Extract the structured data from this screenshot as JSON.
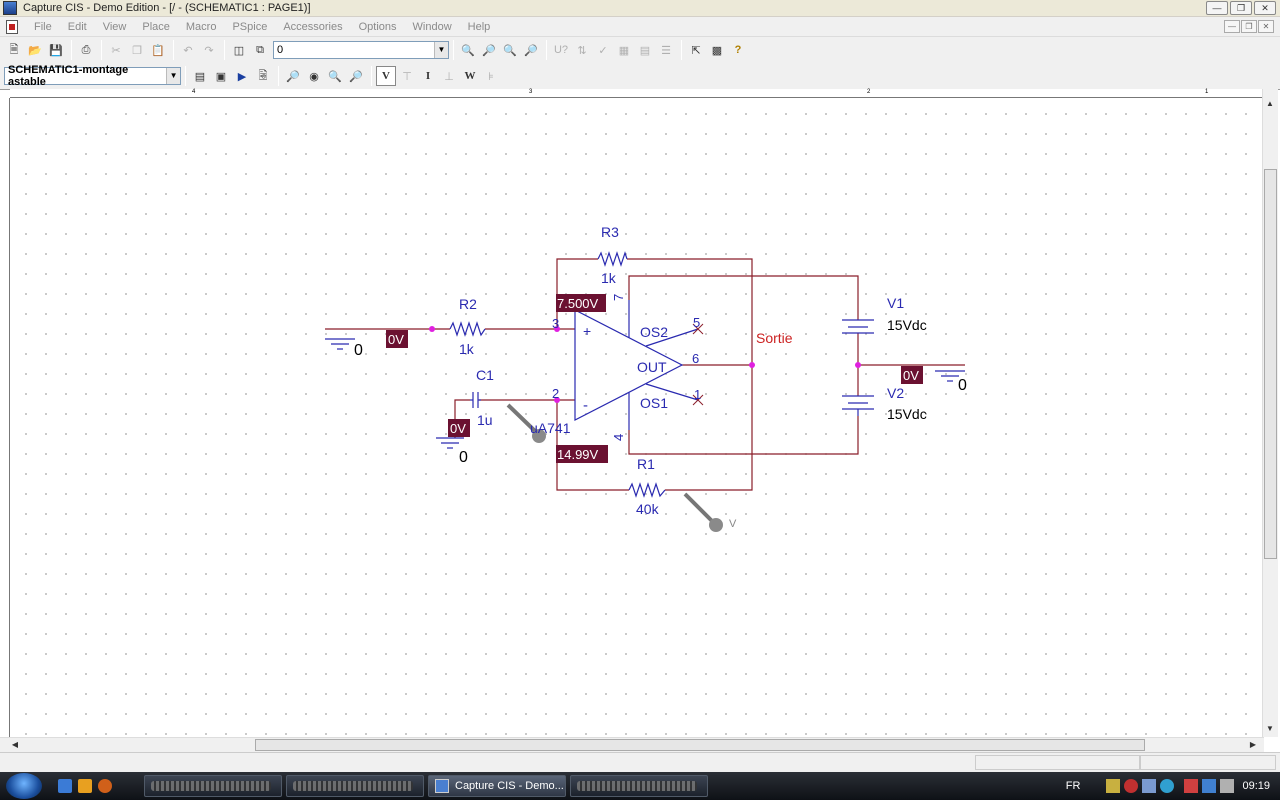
{
  "window": {
    "title": "Capture CIS - Demo Edition - [/ - (SCHEMATIC1 : PAGE1)]"
  },
  "menu": [
    "File",
    "Edit",
    "View",
    "Place",
    "Macro",
    "PSpice",
    "Accessories",
    "Options",
    "Window",
    "Help"
  ],
  "toolbar": {
    "part_combo_value": "0",
    "schematic_combo_value": "SCHEMATIC1-montage astable"
  },
  "ruler": {
    "top_marks": [
      "4",
      "3",
      "2",
      "1"
    ]
  },
  "schematic": {
    "components": {
      "r3": {
        "ref": "R3",
        "value": "1k"
      },
      "r2": {
        "ref": "R2",
        "value": "1k"
      },
      "r1": {
        "ref": "R1",
        "value": "40k"
      },
      "c1": {
        "ref": "C1",
        "value": "1u"
      },
      "u1": {
        "part": "uA741",
        "pin3": "3",
        "pin2": "2",
        "pin7": "7",
        "pin4": "4",
        "pin5": "5",
        "pin6": "6",
        "pin1": "1",
        "plus": "+",
        "minus": "-",
        "os2": "OS2",
        "out": "OUT",
        "os1": "OS1"
      },
      "v1": {
        "ref": "V1",
        "value": "15Vdc"
      },
      "v2": {
        "ref": "V2",
        "value": "15Vdc"
      }
    },
    "net_label": "Sortie",
    "ground_labels": [
      "0",
      "0",
      "0"
    ],
    "bias_voltages": [
      "0V",
      "7.500V",
      "0V",
      "14.99V",
      "0V"
    ],
    "probe_label": "V",
    "colors": {
      "wire": "#8a1e2a",
      "part": "#2a2ab0",
      "node": "#e020e0",
      "bias_bg": "#6b1131",
      "net_label": "#cc2222"
    }
  },
  "taskbar": {
    "active_task": "Capture CIS - Demo...",
    "language": "FR",
    "clock": "09:19"
  }
}
